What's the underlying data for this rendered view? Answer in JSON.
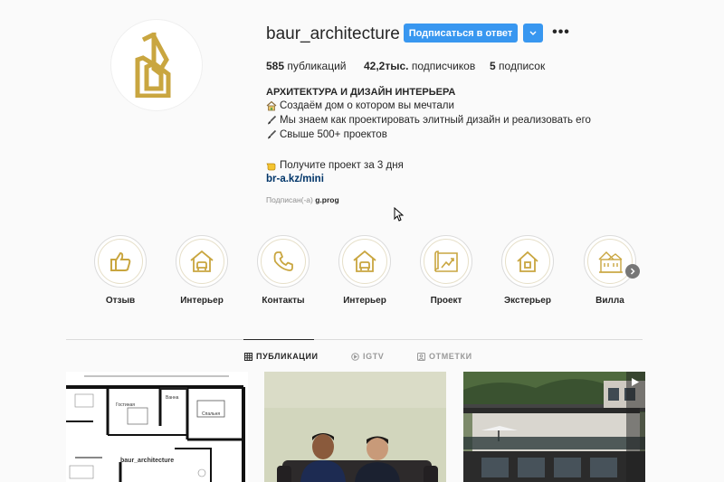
{
  "profile": {
    "username": "baur_architecture",
    "follow_label": "Подписаться в ответ",
    "more_label": "•••",
    "stats": {
      "posts_count": "585",
      "posts_label": "публикаций",
      "followers_count": "42,2тыс.",
      "followers_label": "подписчиков",
      "following_count": "5",
      "following_label": "подписок"
    },
    "bio": {
      "name": "АРХИТЕКТУРА И ДИЗАЙН ИНТЕРЬЕРА",
      "line1": "Создаём дом о котором вы мечтали",
      "line2": "Мы знаем как проектировать элитный дизайн и реализовать его",
      "line3": "Свыше 500+ проектов",
      "line4": "Получите проект за 3 дня",
      "link": "br-a.kz/mini"
    },
    "followed_by_prefix": "Подписан(-а)",
    "followed_by_user": "g.prog"
  },
  "highlights": [
    {
      "label": "Отзыв",
      "icon": "thumbs-up-icon"
    },
    {
      "label": "Интерьер",
      "icon": "house-interior-icon"
    },
    {
      "label": "Контакты",
      "icon": "phone-icon"
    },
    {
      "label": "Интерьер",
      "icon": "house-interior-icon"
    },
    {
      "label": "Проект",
      "icon": "blueprint-icon"
    },
    {
      "label": "Экстерьер",
      "icon": "house-icon"
    },
    {
      "label": "Вилла",
      "icon": "villa-icon"
    }
  ],
  "tabs": {
    "posts": "ПУБЛИКАЦИИ",
    "igtv": "IGTV",
    "tagged": "ОТМЕТКИ"
  },
  "posts": {
    "tile1_text": "baur_architecture",
    "tile1_rooms": [
      "Гостиная",
      "Ванна",
      "Спальня"
    ]
  },
  "colors": {
    "accent": "#3897f0",
    "gold": "#c9a640",
    "link": "#003569"
  }
}
